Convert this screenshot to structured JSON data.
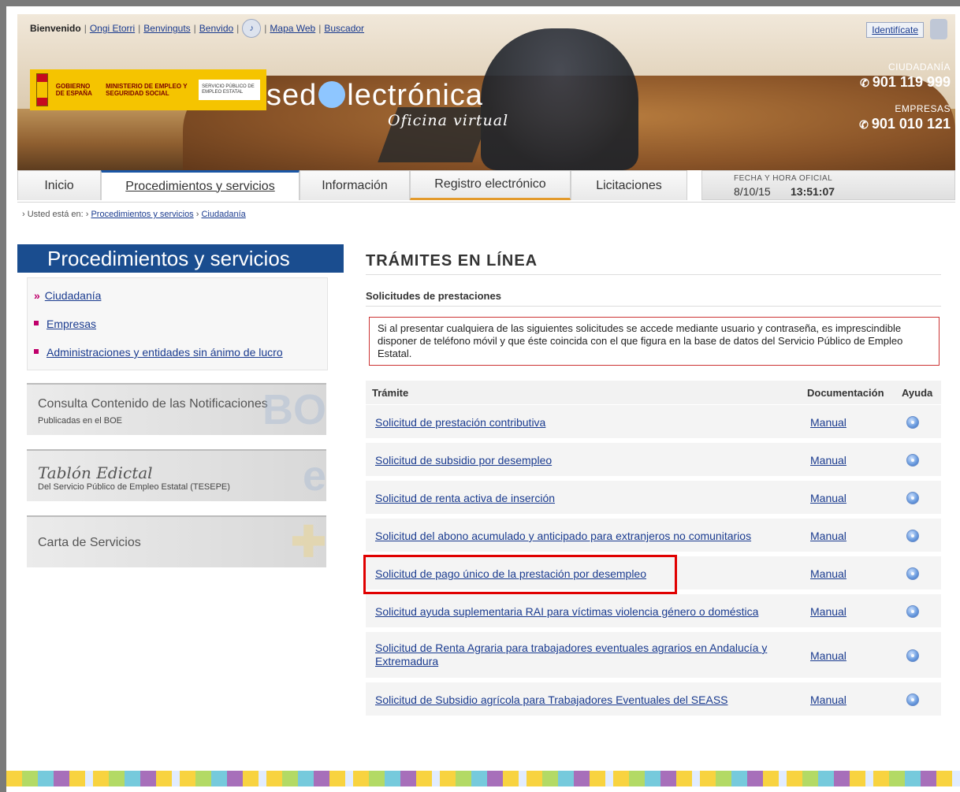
{
  "header": {
    "welcome": "Bienvenido",
    "nav_links": [
      "Ongi Etorri",
      "Benvinguts",
      "Benvido"
    ],
    "speaker_icon": "speaker-icon",
    "links_right": [
      "Mapa Web",
      "Buscador"
    ],
    "identify": "Identifícate",
    "lock_icon": "lock-icon",
    "logo_text_1": "GOBIERNO DE ESPAÑA",
    "logo_text_2": "MINISTERIO DE EMPLEO Y SEGURIDAD SOCIAL",
    "logo_text_3": "SERVICIO PÚBLICO DE EMPLEO ESTATAL",
    "site_title_before": "sed",
    "site_title_after": "lectrónica",
    "site_subtitle": "Oficina virtual",
    "phone_label_1": "CIUDADANÍA",
    "phone_1": "901 119 999",
    "phone_label_2": "EMPRESAS",
    "phone_2": "901 010 121",
    "phone_icon": "phone-icon"
  },
  "tabs": [
    {
      "label": "Inicio"
    },
    {
      "label": "Procedimientos y servicios"
    },
    {
      "label": "Información"
    },
    {
      "label": "Registro electrónico"
    },
    {
      "label": "Licitaciones"
    }
  ],
  "clock": {
    "label": "FECHA Y HORA OFICIAL",
    "date": "8/10/15",
    "time": "13:51:07"
  },
  "breadcrumb": {
    "prefix": "Usted está en:",
    "items": [
      "Procedimientos y servicios",
      "Ciudadanía"
    ]
  },
  "sidebar": {
    "title": "Procedimientos y servicios",
    "items": [
      {
        "label": "Ciudadanía"
      },
      {
        "label": "Empresas"
      },
      {
        "label": "Administraciones y entidades sin ánimo de lucro"
      }
    ],
    "panels": [
      {
        "title": "Consulta Contenido de las Notificaciones",
        "subtitle": "Publicadas en el BOE",
        "deco": "BO"
      },
      {
        "title": "Tablón Edictal",
        "subtitle": "Del Servicio Público de Empleo Estatal (TESEPE)",
        "deco": "e"
      },
      {
        "title": "Carta de Servicios"
      }
    ]
  },
  "main": {
    "title": "TRÁMITES EN LÍNEA",
    "section": "Solicitudes de prestaciones",
    "notice": "Si al presentar cualquiera de las siguientes solicitudes se accede mediante usuario y contraseña, es imprescindible disponer de teléfono móvil y que éste coincida con el que figura en la base de datos del Servicio Público de Empleo Estatal.",
    "table": {
      "headers": [
        "Trámite",
        "Documentación",
        "Ayuda"
      ],
      "rows": [
        {
          "tramite": "Solicitud de prestación contributiva",
          "doc": "Manual"
        },
        {
          "tramite": "Solicitud de subsidio por desempleo",
          "doc": "Manual"
        },
        {
          "tramite": "Solicitud de renta activa de inserción",
          "doc": "Manual"
        },
        {
          "tramite": "Solicitud del abono acumulado y anticipado para extranjeros no comunitarios",
          "doc": "Manual"
        },
        {
          "tramite": "Solicitud de pago único de la prestación por desempleo",
          "doc": "Manual"
        },
        {
          "tramite": "Solicitud ayuda suplementaria RAI para víctimas violencia género o doméstica",
          "doc": "Manual"
        },
        {
          "tramite": "Solicitud de Renta Agraria para trabajadores eventuales agrarios en Andalucía y Extremadura",
          "doc": "Manual"
        },
        {
          "tramite": "Solicitud de Subsidio agrícola para Trabajadores Eventuales del SEASS",
          "doc": "Manual"
        }
      ]
    }
  },
  "colors": {
    "brand_blue": "#1a4d8f",
    "link": "#1a3b8f",
    "highlight": "#e00000",
    "bullet": "#c0006b"
  }
}
